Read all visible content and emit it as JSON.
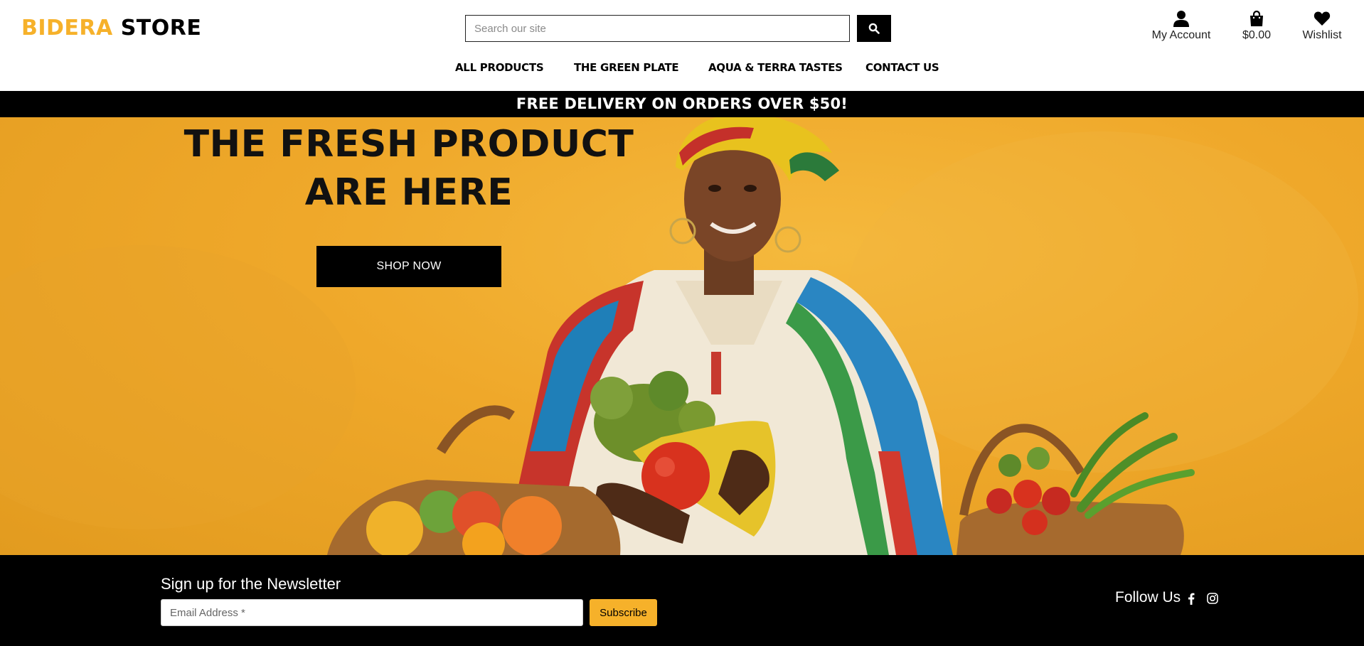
{
  "header": {
    "logo_brand": "BIDERA",
    "logo_store": "STORE",
    "search_placeholder": "Search our site",
    "account_label": "My Account",
    "cart_total": "$0.00",
    "wishlist_label": "Wishlist",
    "icons": [
      "search-icon",
      "user-icon",
      "shopping-bag-icon",
      "heart-icon"
    ]
  },
  "nav": {
    "items": [
      {
        "label": "All Products"
      },
      {
        "label": "The Green Plate"
      },
      {
        "label": "Aqua & Terra Tastes"
      },
      {
        "label": "Contact Us"
      }
    ]
  },
  "banner": {
    "text": "FREE DELIVERY ON ORDERS OVER $50!"
  },
  "hero": {
    "title": "THE FRESH PRODUCT ARE HERE",
    "button_label": "SHOP NOW"
  },
  "footer": {
    "newsletter_title": "Sign up for the Newsletter",
    "email_placeholder": "Email Address *",
    "subscribe_label": "Subscribe",
    "follow_label": "Follow Us",
    "social_icons": [
      "facebook-icon",
      "instagram-icon"
    ]
  },
  "colors": {
    "accent": "#f6b12a",
    "banner_bg": "#000000",
    "hero_bg": "#efa82a"
  }
}
